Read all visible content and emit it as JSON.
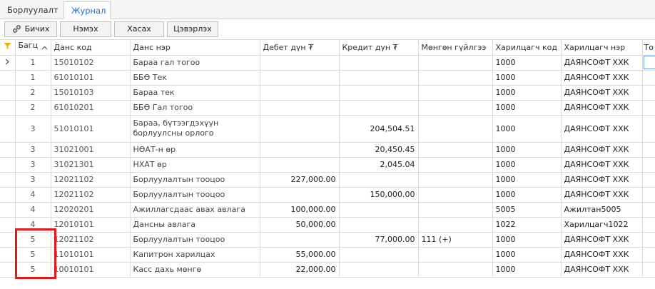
{
  "tabs": [
    "Борлуулалт",
    "Журнал"
  ],
  "toolbar": {
    "write": "Бичих",
    "add": "Нэмэх",
    "remove": "Хасах",
    "clear": "Цэвэрлэх"
  },
  "columns": {
    "group": "Багц",
    "code": "Данс код",
    "name": "Данс нэр",
    "debit": "Дебет дүн ₮",
    "credit": "Кредит дүн ₮",
    "cash": "Мөнгөн гүйлгээ",
    "pcode": "Харилцагч код",
    "pname": "Харилцагч нэр",
    "extra": "То"
  },
  "colors": {
    "accent": "#1e6fd0",
    "highlight": "#e41a1a",
    "filter": "#f0b400"
  },
  "rows": [
    {
      "group": "1",
      "code": "15010102",
      "name": "Бараа гал тогоо",
      "debit": "",
      "credit": "",
      "cash": "",
      "pcode": "1000",
      "pname": "ДАЯНСОФТ ХХК"
    },
    {
      "group": "1",
      "code": "61010101",
      "name": "ББӨ Тек",
      "debit": "",
      "credit": "",
      "cash": "",
      "pcode": "1000",
      "pname": "ДАЯНСОФТ ХХК"
    },
    {
      "group": "2",
      "code": "15010103",
      "name": "Бараа тек",
      "debit": "",
      "credit": "",
      "cash": "",
      "pcode": "1000",
      "pname": "ДАЯНСОФТ ХХК"
    },
    {
      "group": "2",
      "code": "61010201",
      "name": "ББӨ Гал тогоо",
      "debit": "",
      "credit": "",
      "cash": "",
      "pcode": "1000",
      "pname": "ДАЯНСОФТ ХХК"
    },
    {
      "group": "3",
      "code": "51010101",
      "name": "Бараа, бүтээгдэхүүн борлуулсны орлого",
      "debit": "",
      "credit": "204,504.51",
      "cash": "",
      "pcode": "1000",
      "pname": "ДАЯНСОФТ ХХК"
    },
    {
      "group": "3",
      "code": "31021001",
      "name": "НӨАТ-н өр",
      "debit": "",
      "credit": "20,450.45",
      "cash": "",
      "pcode": "1000",
      "pname": "ДАЯНСОФТ ХХК"
    },
    {
      "group": "3",
      "code": "31021301",
      "name": "НХАТ өр",
      "debit": "",
      "credit": "2,045.04",
      "cash": "",
      "pcode": "1000",
      "pname": "ДАЯНСОФТ ХХК"
    },
    {
      "group": "3",
      "code": "12021102",
      "name": "Борлуулалтын тооцоо",
      "debit": "227,000.00",
      "credit": "",
      "cash": "",
      "pcode": "1000",
      "pname": "ДАЯНСОФТ ХХК"
    },
    {
      "group": "4",
      "code": "12021102",
      "name": "Борлуулалтын тооцоо",
      "debit": "",
      "credit": "150,000.00",
      "cash": "",
      "pcode": "1000",
      "pname": "ДАЯНСОФТ ХХК"
    },
    {
      "group": "4",
      "code": "12020201",
      "name": "Ажиллагсдаас авах авлага",
      "debit": "100,000.00",
      "credit": "",
      "cash": "",
      "pcode": "5005",
      "pname": "Ажилтан5005"
    },
    {
      "group": "4",
      "code": "12010101",
      "name": "Дансны авлага",
      "debit": "50,000.00",
      "credit": "",
      "cash": "",
      "pcode": "1022",
      "pname": "Харилцагч1022"
    },
    {
      "group": "5",
      "code": "12021102",
      "name": "Борлуулалтын тооцоо",
      "debit": "",
      "credit": "77,000.00",
      "cash": "111 (+)",
      "pcode": "1000",
      "pname": "ДАЯНСОФТ ХХК"
    },
    {
      "group": "5",
      "code": "11010101",
      "name": "Капитрон харилцах",
      "debit": "55,000.00",
      "credit": "",
      "cash": "",
      "pcode": "1000",
      "pname": "ДАЯНСОФТ ХХК"
    },
    {
      "group": "5",
      "code": "10010101",
      "name": "Касс дахь мөнгө",
      "debit": "22,000.00",
      "credit": "",
      "cash": "",
      "pcode": "1000",
      "pname": "ДАЯНСОФТ ХХК"
    }
  ]
}
